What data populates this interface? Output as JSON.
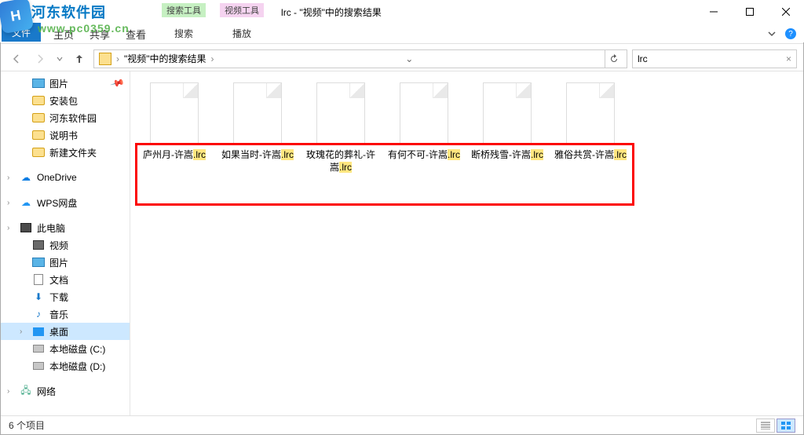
{
  "watermark": {
    "logo_text": "文件",
    "site_name": "河东软件园",
    "url": "www.pc0359.cn"
  },
  "titlebar": {
    "context_tabs": [
      {
        "title": "搜索工具",
        "tab": "搜索"
      },
      {
        "title": "视频工具",
        "tab": "播放"
      }
    ],
    "title": "lrc - \"视频\"中的搜索结果"
  },
  "ribbon": {
    "file_tab": "文件",
    "tabs": [
      "主页",
      "共享",
      "查看"
    ]
  },
  "navbar": {
    "breadcrumb": {
      "root_sep": "›",
      "item": "\"视频\"中的搜索结果",
      "sep": "›",
      "drop": "⌄",
      "refresh": "↻"
    },
    "search_value": "lrc"
  },
  "sidebar": {
    "items": [
      {
        "label": "图片",
        "icon": "pic"
      },
      {
        "label": "安装包",
        "icon": "folder"
      },
      {
        "label": "河东软件园",
        "icon": "folder"
      },
      {
        "label": "说明书",
        "icon": "folder"
      },
      {
        "label": "新建文件夹",
        "icon": "folder"
      },
      {
        "spacer": true
      },
      {
        "label": "OneDrive",
        "icon": "onedrive",
        "chev": ">"
      },
      {
        "spacer": true
      },
      {
        "label": "WPS网盘",
        "icon": "wps",
        "chev": ">"
      },
      {
        "spacer": true
      },
      {
        "label": "此电脑",
        "icon": "pc",
        "chev": ">"
      },
      {
        "label": "视频",
        "icon": "video",
        "sub": true
      },
      {
        "label": "图片",
        "icon": "pic",
        "sub": true
      },
      {
        "label": "文档",
        "icon": "doc",
        "sub": true
      },
      {
        "label": "下载",
        "icon": "download",
        "sub": true
      },
      {
        "label": "音乐",
        "icon": "music",
        "sub": true
      },
      {
        "label": "桌面",
        "icon": "desktop",
        "sub": true,
        "selected": true,
        "chev": ">"
      },
      {
        "label": "本地磁盘 (C:)",
        "icon": "disk",
        "sub": true
      },
      {
        "label": "本地磁盘 (D:)",
        "icon": "disk",
        "sub": true
      },
      {
        "spacer": true
      },
      {
        "label": "网络",
        "icon": "network",
        "chev": ">"
      }
    ]
  },
  "files": [
    {
      "name_pre": "庐州月-许嵩",
      "hl": ".lrc"
    },
    {
      "name_pre": "如果当时-许嵩",
      "hl": ".lrc"
    },
    {
      "name_pre": "玫瑰花的葬礼-许嵩",
      "hl": ".lrc"
    },
    {
      "name_pre": "有何不可-许嵩",
      "hl": ".lrc"
    },
    {
      "name_pre": "断桥残雪-许嵩",
      "hl": ".lrc"
    },
    {
      "name_pre": "雅俗共赏-许嵩",
      "hl": ".lrc"
    }
  ],
  "statusbar": {
    "count": "6 个项目"
  }
}
